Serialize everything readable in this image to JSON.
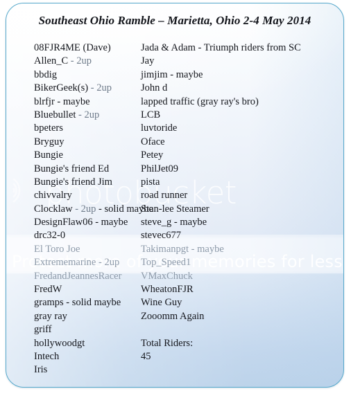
{
  "document": {
    "title": "Southeast Ohio Ramble – Marietta, Ohio 2-4 May 2014"
  },
  "watermark": {
    "wordmark": "photobucket",
    "tagline": "Protect more of your memories for less!",
    "logo_icon": "photobucket-ripple-icon"
  },
  "colors": {
    "border": "#54a8cb",
    "panel_top": "#ffffff",
    "panel_bottom": "#bcd3ea",
    "text": "#14161c",
    "faded_text": "#8d9aa9",
    "watermark_text": "#ffffff"
  },
  "riders": {
    "left_column": [
      "08FJR4ME (Dave)",
      "Allen_C - 2up",
      "bbdig",
      "BikerGeek(s) - 2up",
      "blrfjr - maybe",
      "Bluebullet - 2up",
      "bpeters",
      "Bryguy",
      "Bungie",
      "Bungie's friend Ed",
      "Bungie's friend Jim",
      "chivvalry",
      "Clocklaw - 2up - solid maybe",
      "DesignFlaw06 - maybe",
      "drc32-0",
      "El Toro Joe",
      "Extrememarine - 2up",
      "FredandJeannesRacer",
      "FredW",
      "gramps - solid maybe",
      "gray ray",
      "griff",
      "hollywoodgt",
      "Intech",
      "Iris"
    ],
    "right_column": [
      "Jada & Adam - Triumph riders from SC",
      "Jay",
      "jimjim - maybe",
      "John d",
      "lapped traffic (gray ray's bro)",
      "LCB",
      "luvtoride",
      "Oface",
      "Petey",
      "PhilJet09",
      "pista",
      "road runner",
      "Stan-lee Steamer",
      "steve_g - maybe",
      "stevec677",
      "Takimanpgt - maybe",
      "Top_Speed1",
      "VMaxChuck",
      "WheatonFJR",
      "Wine Guy",
      "Zooomm Again",
      "",
      "Total Riders:",
      "45"
    ]
  }
}
